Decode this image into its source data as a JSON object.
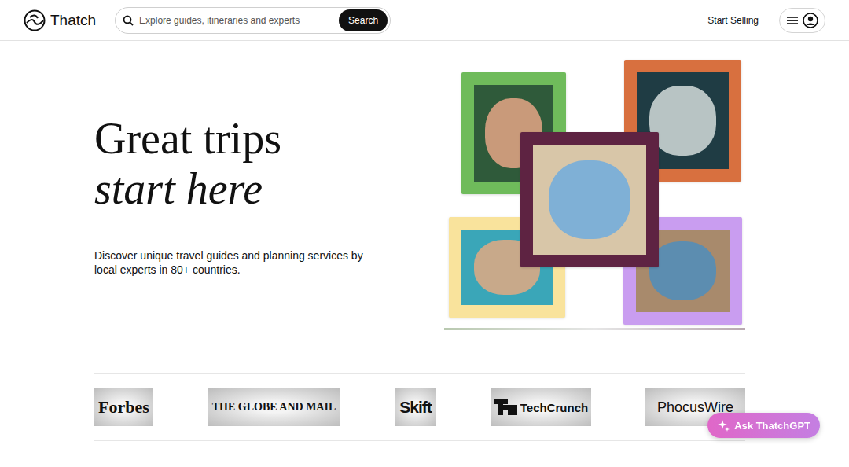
{
  "header": {
    "logo": "Thatch",
    "search": {
      "placeholder": "Explore guides, itineraries and experts",
      "button": "Search"
    },
    "start_selling": "Start Selling"
  },
  "hero": {
    "title_line1": "Great trips",
    "title_line2": "start here",
    "subtitle": "Discover unique travel guides and planning services by local experts in 80+ countries."
  },
  "collage": [
    {
      "color": "#6fbb5b"
    },
    {
      "color": "#d8703f"
    },
    {
      "color": "#f9e39c"
    },
    {
      "color": "#c99df0"
    },
    {
      "color": "#5e2342"
    }
  ],
  "press": [
    {
      "name": "Forbes",
      "kind": "forbes"
    },
    {
      "name": "THE GLOBE AND MAIL",
      "kind": "globe"
    },
    {
      "name": "Skift",
      "kind": "skift"
    },
    {
      "name": "TechCrunch",
      "kind": "techcrunch"
    },
    {
      "name": "PhocusWire",
      "kind": "phocuswire"
    }
  ],
  "assistant": {
    "label": "Ask ThatchGPT"
  }
}
